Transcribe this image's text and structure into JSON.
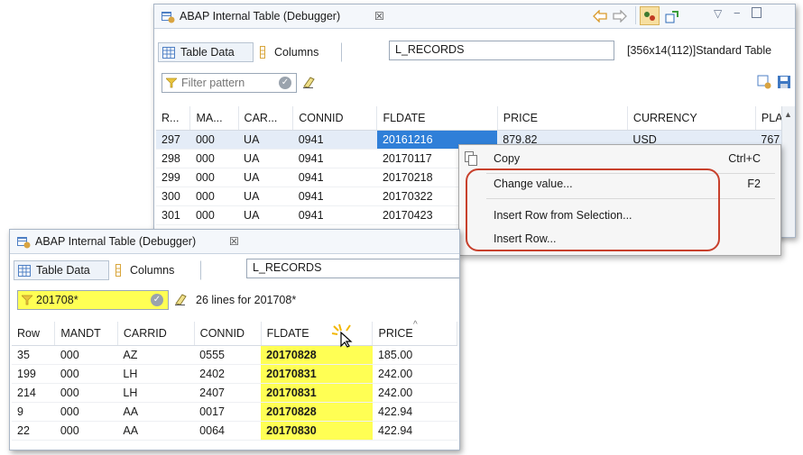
{
  "top_window": {
    "title": "ABAP Internal Table (Debugger)",
    "close": "☒",
    "tabs": {
      "table_data": "Table Data",
      "columns": "Columns"
    },
    "variable_name": "L_RECORDS",
    "table_info": "[356x14(112)]Standard Table",
    "filter": {
      "placeholder": "Filter pattern",
      "value": ""
    },
    "columns": [
      "R...",
      "MA...",
      "CAR...",
      "CONNID",
      "FLDATE",
      "PRICE",
      "CURRENCY",
      "PLA"
    ],
    "rows": [
      [
        "297",
        "000",
        "UA",
        "0941",
        "20161216",
        "879.82",
        "USD",
        "767"
      ],
      [
        "298",
        "000",
        "UA",
        "0941",
        "20170117",
        "",
        "",
        ""
      ],
      [
        "299",
        "000",
        "UA",
        "0941",
        "20170218",
        "",
        "",
        ""
      ],
      [
        "300",
        "000",
        "UA",
        "0941",
        "20170322",
        "",
        "",
        ""
      ],
      [
        "301",
        "000",
        "UA",
        "0941",
        "20170423",
        "",
        "",
        ""
      ]
    ]
  },
  "context_menu": {
    "items": [
      {
        "label": "Copy",
        "accelerator": "Ctrl+C"
      },
      {
        "label": "Change value...",
        "accelerator": "F2"
      },
      {
        "label": "Insert Row from Selection...",
        "accelerator": ""
      },
      {
        "label": "Insert Row...",
        "accelerator": ""
      }
    ]
  },
  "bottom_window": {
    "title": "ABAP Internal Table (Debugger)",
    "close": "☒",
    "tabs": {
      "table_data": "Table Data",
      "columns": "Columns"
    },
    "variable_name": "L_RECORDS",
    "filter": {
      "value": "201708*",
      "status": "26 lines for 201708*"
    },
    "columns": [
      "Row",
      "MANDT",
      "CARRID",
      "CONNID",
      "FLDATE",
      "PRICE"
    ],
    "rows": [
      [
        "35",
        "000",
        "AZ",
        "0555",
        "20170828",
        "185.00"
      ],
      [
        "199",
        "000",
        "LH",
        "2402",
        "20170831",
        "242.00"
      ],
      [
        "214",
        "000",
        "LH",
        "2407",
        "20170831",
        "242.00"
      ],
      [
        "9",
        "000",
        "AA",
        "0017",
        "20170828",
        "422.94"
      ],
      [
        "22",
        "000",
        "AA",
        "0064",
        "20170830",
        "422.94"
      ]
    ]
  },
  "colors": {
    "highlight": "#ffff54",
    "selection": "#2f7fd8",
    "annotation": "#c8402c"
  }
}
